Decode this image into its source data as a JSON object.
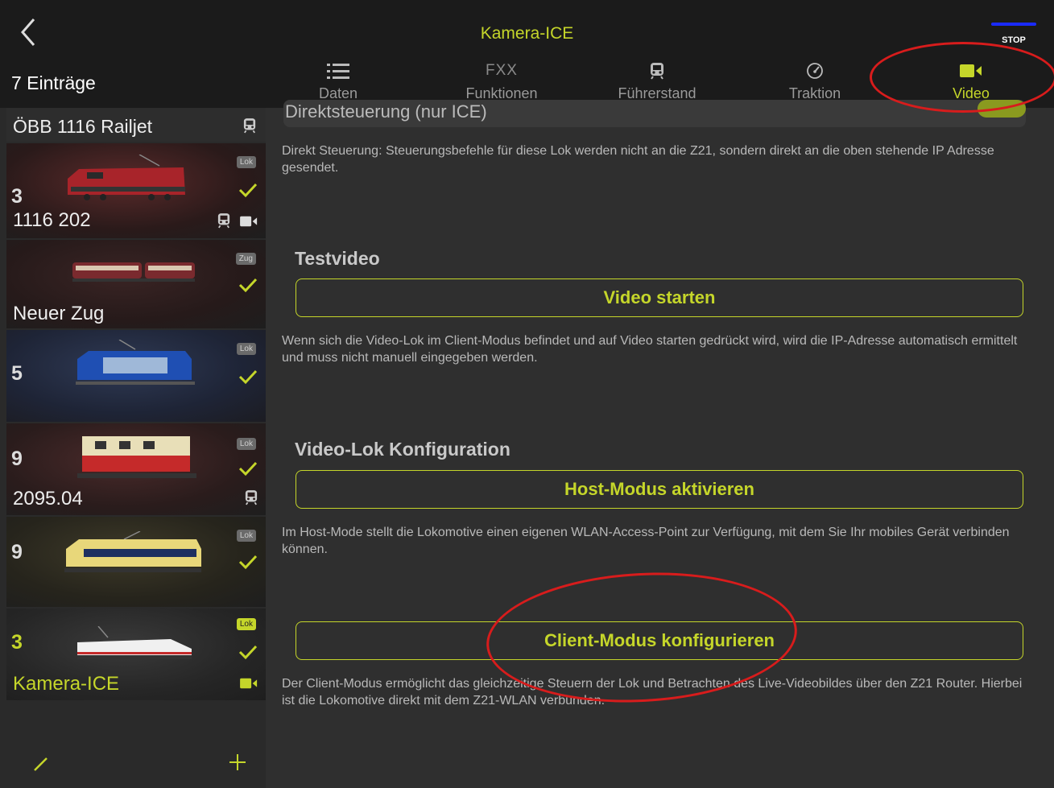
{
  "header": {
    "title": "Kamera-ICE",
    "stop_label": "STOP",
    "entries_count": "7 Einträge"
  },
  "tabs": [
    {
      "label": "Daten",
      "icon": "list-icon"
    },
    {
      "label": "Funktionen",
      "icon": "fxx-icon",
      "icon_text": "FXX"
    },
    {
      "label": "Führerstand",
      "icon": "train-icon"
    },
    {
      "label": "Traktion",
      "icon": "speedometer-icon"
    },
    {
      "label": "Video",
      "icon": "video-camera-icon",
      "active": true
    }
  ],
  "sidebar": {
    "entries": [
      {
        "name": "ÖBB 1116 Railjet",
        "type": "header"
      },
      {
        "address": "3",
        "name": "1116 202",
        "badge": "Lok"
      },
      {
        "badge": "Zug",
        "name": "Neuer Zug"
      },
      {
        "address": "5",
        "badge": "Lok"
      },
      {
        "address": "9",
        "name": "2095.04",
        "badge": "Lok"
      },
      {
        "address": "9",
        "badge": "Lok"
      },
      {
        "address": "3",
        "name": "Kamera-ICE",
        "badge": "Lok",
        "selected": true
      }
    ]
  },
  "main": {
    "direct_label": "Direktsteuerung (nur ICE)",
    "direct_desc": "Direkt Steuerung: Steuerungsbefehle für diese Lok werden nicht an die Z21, sondern direkt  an die oben stehende IP Adresse gesendet.",
    "testvideo_heading": "Testvideo",
    "video_start_button": "Video starten",
    "video_start_desc": "Wenn sich die Video-Lok im Client-Modus befindet und auf Video starten gedrückt wird, wird die IP-Adresse automatisch ermittelt und muss nicht manuell eingegeben werden.",
    "config_heading": "Video-Lok Konfiguration",
    "host_button": "Host-Modus aktivieren",
    "host_desc": "Im Host-Mode stellt die Lokomotive einen eigenen WLAN-Access-Point zur Verfügung, mit dem Sie Ihr mobiles Gerät verbinden können.",
    "client_button": "Client-Modus konfigurieren",
    "client_desc": "Der Client-Modus ermöglicht das gleichzeitige Steuern der Lok und Betrachten des Live-Videobildes über den Z21 Router. Hierbei ist die Lokomotive direkt mit dem Z21-WLAN verbunden."
  },
  "colors": {
    "accent": "#c5d62a",
    "annotation": "#d81c1c"
  }
}
